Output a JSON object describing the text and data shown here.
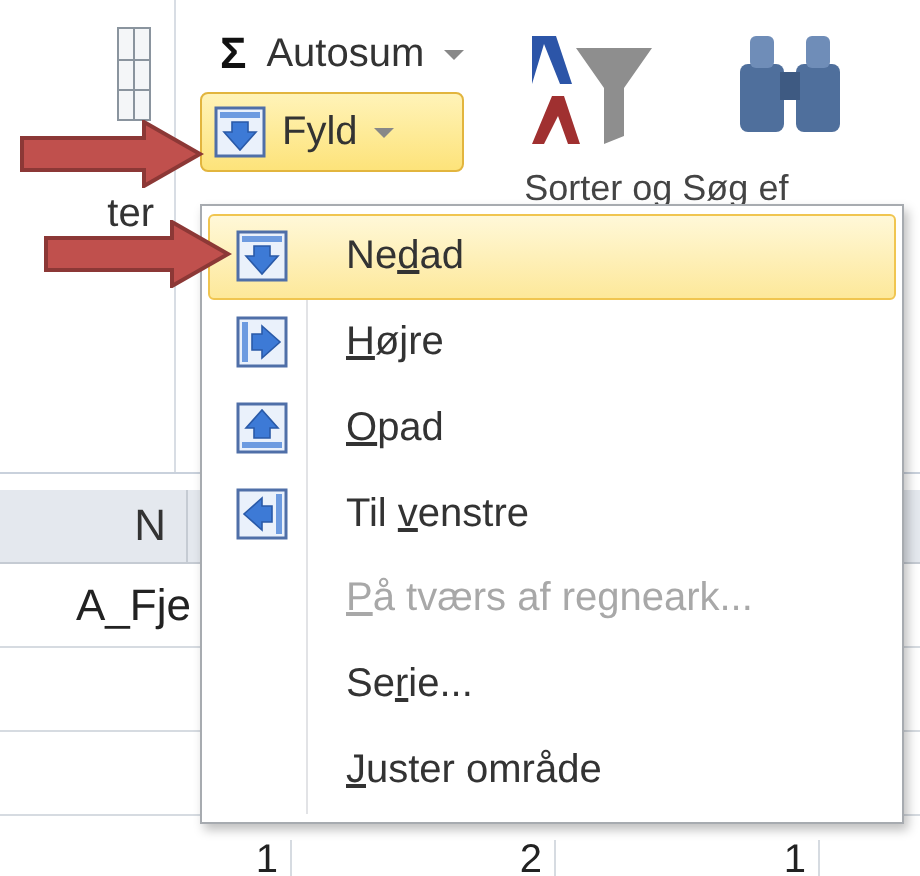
{
  "ribbon": {
    "left_group_label": "ter",
    "autosum": {
      "symbol": "Σ",
      "label": "Autosum"
    },
    "fill_button": {
      "label": "Fyld",
      "expanded": true
    },
    "sort_group_label": "Sorter og Søg ef"
  },
  "menu": {
    "items": [
      {
        "kind": "down",
        "label": {
          "before": "Ne",
          "underlined": "d",
          "after": "ad"
        },
        "selected": true,
        "disabled": false
      },
      {
        "kind": "right",
        "label": {
          "underlined": "H",
          "after": "øjre"
        },
        "selected": false,
        "disabled": false
      },
      {
        "kind": "up",
        "label": {
          "underlined": "O",
          "after": "pad"
        },
        "selected": false,
        "disabled": false
      },
      {
        "kind": "left",
        "label": {
          "before": "Til ",
          "underlined": "v",
          "after": "enstre"
        },
        "selected": false,
        "disabled": false
      },
      {
        "kind": "plain",
        "label": {
          "underlined": "P",
          "after": "å tværs af regneark..."
        },
        "selected": false,
        "disabled": true
      },
      {
        "kind": "plain",
        "label": {
          "before": "Se",
          "underlined": "r",
          "after": "ie..."
        },
        "selected": false,
        "disabled": false
      },
      {
        "kind": "plain",
        "label": {
          "underlined": "J",
          "after": "uster område"
        },
        "selected": false,
        "disabled": false
      }
    ]
  },
  "sheet": {
    "column_header": "N",
    "cell_text": "A_Fje",
    "bottom_row": [
      "1",
      "2",
      "1"
    ]
  }
}
